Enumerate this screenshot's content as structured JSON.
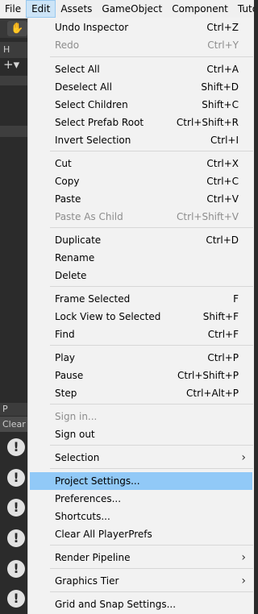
{
  "menubar": {
    "items": [
      "File",
      "Edit",
      "Assets",
      "GameObject",
      "Component",
      "Tutoria"
    ]
  },
  "background": {
    "hierarchy_tab": "H",
    "plus": "+▾",
    "console_tab": "P",
    "clear_button": "Clear",
    "warning_glyph": "!",
    "hand_glyph": "✋"
  },
  "colors": {
    "menu_bg": "#f2f2f2",
    "highlight": "#91c9f7",
    "active_menu": "#cce4f7",
    "editor_bg": "#2b2b2b"
  },
  "edit_menu": {
    "items": [
      {
        "label": "Undo Inspector",
        "shortcut": "Ctrl+Z"
      },
      {
        "label": "Redo",
        "shortcut": "Ctrl+Y",
        "disabled": true
      },
      {
        "label": "Select All",
        "shortcut": "Ctrl+A"
      },
      {
        "label": "Deselect All",
        "shortcut": "Shift+D"
      },
      {
        "label": "Select Children",
        "shortcut": "Shift+C"
      },
      {
        "label": "Select Prefab Root",
        "shortcut": "Ctrl+Shift+R"
      },
      {
        "label": "Invert Selection",
        "shortcut": "Ctrl+I"
      },
      {
        "label": "Cut",
        "shortcut": "Ctrl+X"
      },
      {
        "label": "Copy",
        "shortcut": "Ctrl+C"
      },
      {
        "label": "Paste",
        "shortcut": "Ctrl+V"
      },
      {
        "label": "Paste As Child",
        "shortcut": "Ctrl+Shift+V",
        "disabled": true
      },
      {
        "label": "Duplicate",
        "shortcut": "Ctrl+D"
      },
      {
        "label": "Rename",
        "shortcut": ""
      },
      {
        "label": "Delete",
        "shortcut": ""
      },
      {
        "label": "Frame Selected",
        "shortcut": "F"
      },
      {
        "label": "Lock View to Selected",
        "shortcut": "Shift+F"
      },
      {
        "label": "Find",
        "shortcut": "Ctrl+F"
      },
      {
        "label": "Play",
        "shortcut": "Ctrl+P"
      },
      {
        "label": "Pause",
        "shortcut": "Ctrl+Shift+P"
      },
      {
        "label": "Step",
        "shortcut": "Ctrl+Alt+P"
      },
      {
        "label": "Sign in...",
        "shortcut": "",
        "disabled": true
      },
      {
        "label": "Sign out",
        "shortcut": ""
      },
      {
        "label": "Selection",
        "shortcut": "",
        "submenu": "›"
      },
      {
        "label": "Project Settings...",
        "shortcut": "",
        "highlighted": true
      },
      {
        "label": "Preferences...",
        "shortcut": ""
      },
      {
        "label": "Shortcuts...",
        "shortcut": ""
      },
      {
        "label": "Clear All PlayerPrefs",
        "shortcut": ""
      },
      {
        "label": "Render Pipeline",
        "shortcut": "",
        "submenu": "›"
      },
      {
        "label": "Graphics Tier",
        "shortcut": "",
        "submenu": "›"
      },
      {
        "label": "Grid and Snap Settings...",
        "shortcut": ""
      }
    ]
  }
}
